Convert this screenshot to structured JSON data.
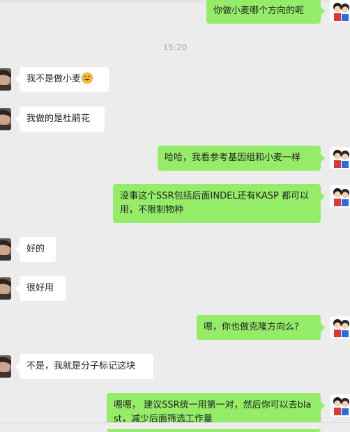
{
  "timestamp": "15:20",
  "messages": [
    {
      "side": "right",
      "text": "你做小麦哪个方向的呢"
    },
    {
      "side": "left",
      "text": "我不是做小麦",
      "emoji": "laughing-face-icon"
    },
    {
      "side": "left",
      "text": "我做的是杜鹃花"
    },
    {
      "side": "right",
      "text": "哈哈，我看参考基因组和小麦一样"
    },
    {
      "side": "right",
      "text": "没事这个SSR包括后面INDEL还有KASP 都可以用，不限制物种"
    },
    {
      "side": "left",
      "text": "好的"
    },
    {
      "side": "left",
      "text": "很好用"
    },
    {
      "side": "right",
      "text": "嗯，你也做克隆方向么?"
    },
    {
      "side": "left",
      "text": "不是，我就是分子标记这块"
    },
    {
      "side": "right",
      "text": "嗯嗯， 建议SSR统一用第一对，然后你可以去blast，减少后面筛选工作量"
    }
  ],
  "colors": {
    "background": "#ececec",
    "bubble_self": "#95ec69",
    "bubble_other": "#ffffff",
    "timestamp": "#a8a8a8"
  }
}
